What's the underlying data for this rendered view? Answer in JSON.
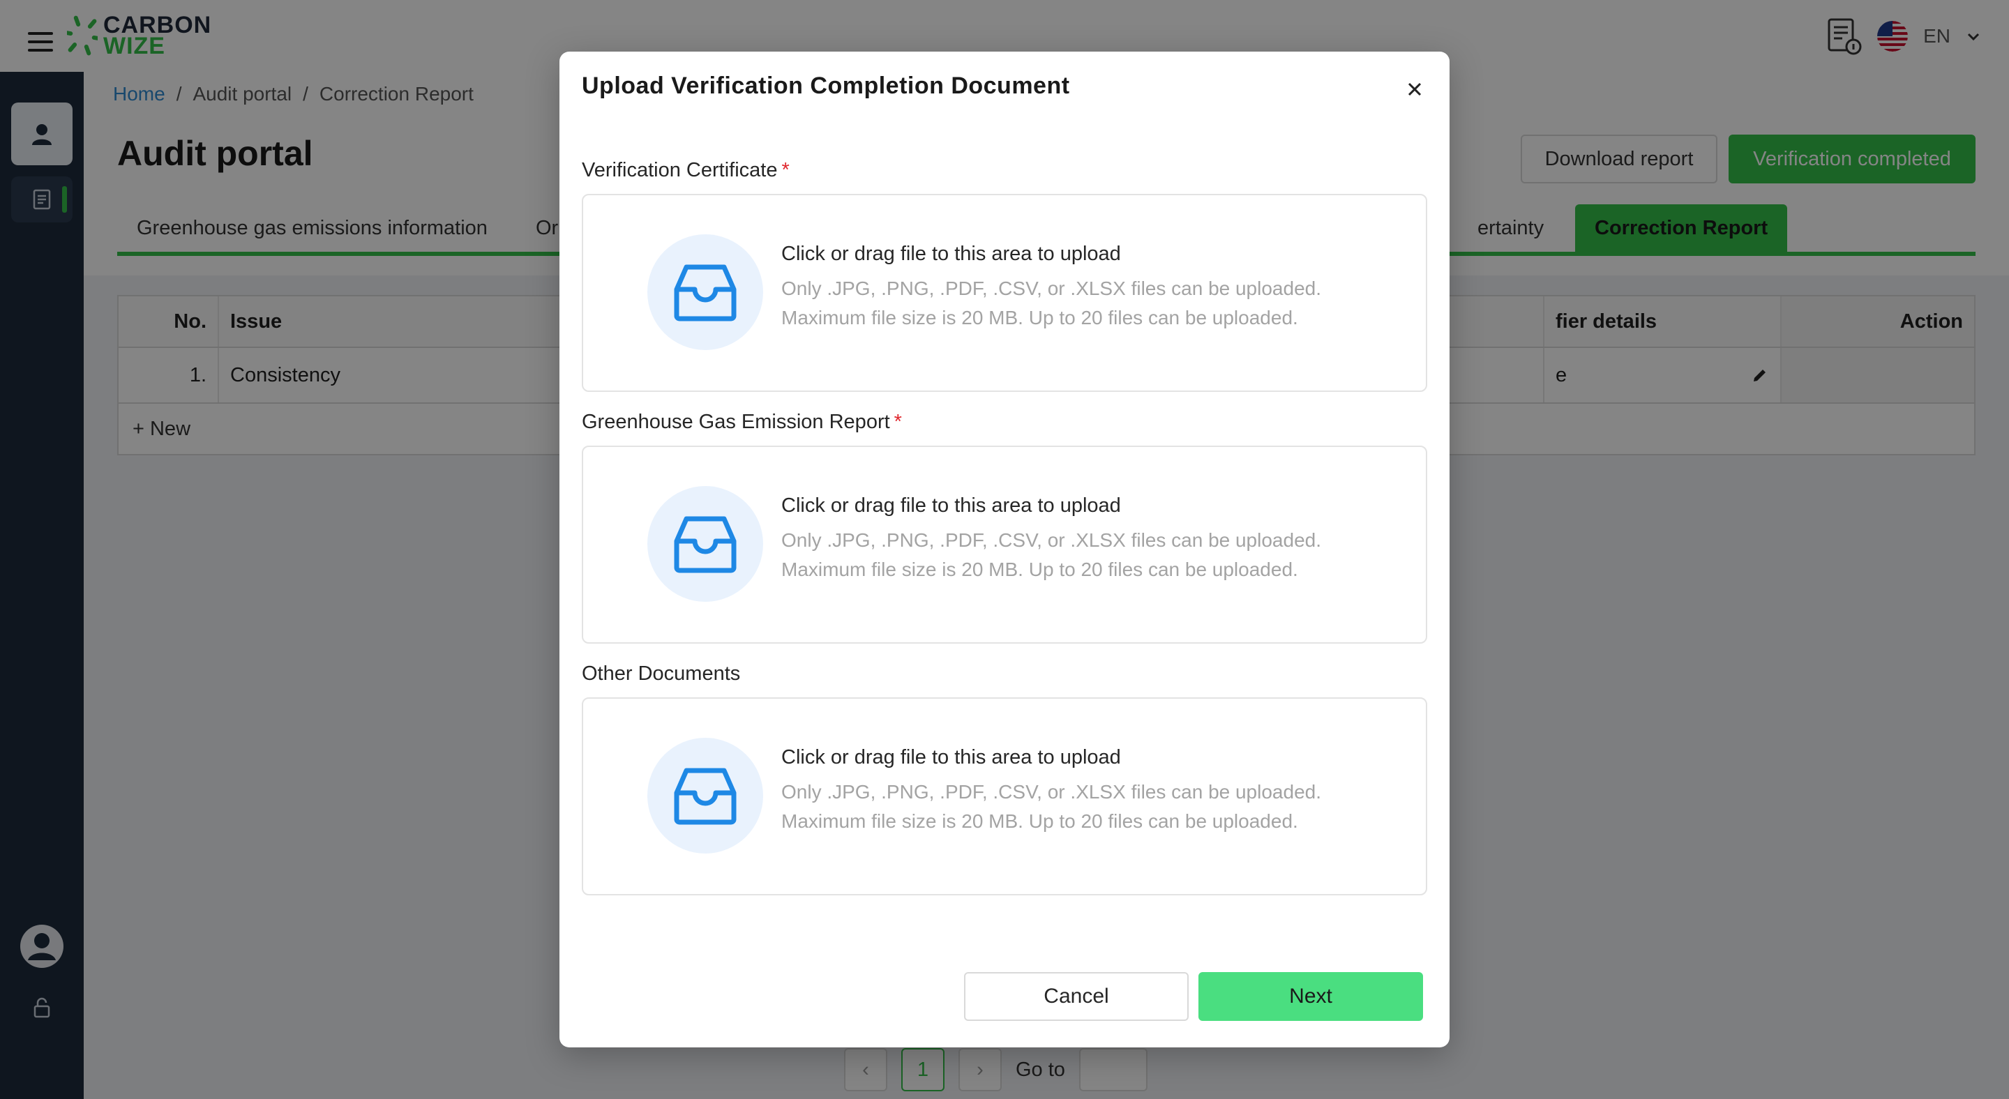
{
  "app": {
    "logo_line1": "CARBON",
    "logo_line2": "WIZE",
    "language": "EN"
  },
  "breadcrumb": [
    "Home",
    "Audit portal",
    "Correction Report"
  ],
  "page": {
    "title": "Audit portal",
    "download_label": "Download report",
    "verified_label": "Verification completed"
  },
  "tabs": [
    "Greenhouse gas emissions information",
    "Or",
    "ertainty",
    "Correction Report"
  ],
  "table": {
    "headers": [
      "No.",
      "Issue",
      "fier details",
      "Action"
    ],
    "rows": [
      {
        "no": "1.",
        "issue": "Consistency",
        "verifier": "e"
      }
    ],
    "new_label": "+ New"
  },
  "pagination": {
    "current": "1",
    "goto_label": "Go to"
  },
  "modal": {
    "title": "Upload Verification Completion Document",
    "fields": [
      {
        "label": "Verification Certificate",
        "required_mark": "*"
      },
      {
        "label": "Greenhouse Gas Emission Report",
        "required_mark": "*"
      },
      {
        "label": "Other Documents"
      }
    ],
    "dropzone_text": "Click or drag file to this area to upload",
    "dropzone_hint1": "Only .JPG, .PNG, .PDF, .CSV, or .XLSX files can be uploaded.",
    "dropzone_hint2": "Maximum file size is 20 MB. Up to 20 files can be uploaded.",
    "cancel_label": "Cancel",
    "next_label": "Next"
  },
  "colors": {
    "brand_green": "#35c04a",
    "next_button": "#4ade80",
    "upload_icon": "#1e88e5",
    "sidebar": "#1e2b3c",
    "required": "#e0282e"
  },
  "icons": [
    "hamburger-icon",
    "report-document-icon",
    "us-flag-icon",
    "chevron-down-icon",
    "user-icon",
    "document-list-icon",
    "avatar-icon",
    "lock-icon",
    "logout-icon",
    "edit-icon",
    "close-icon",
    "inbox-upload-icon"
  ]
}
